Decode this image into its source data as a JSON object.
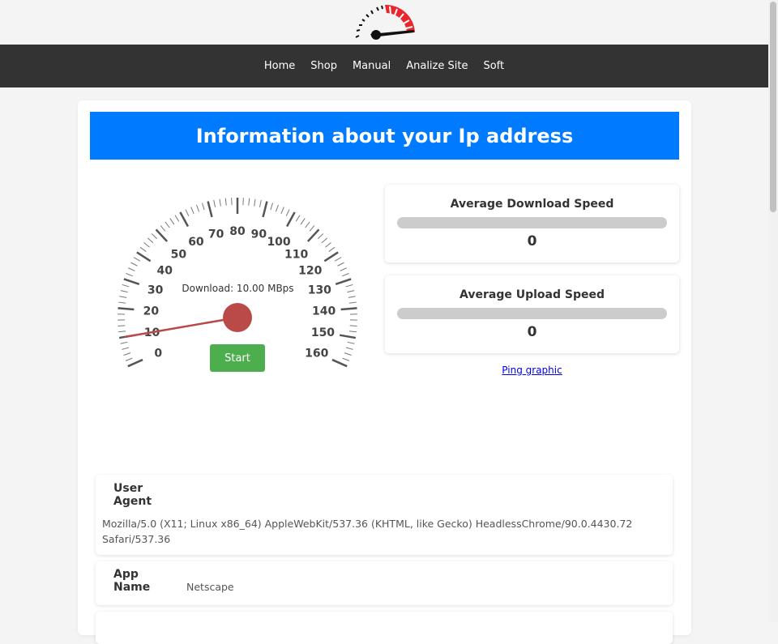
{
  "nav": {
    "items": [
      {
        "label": "Home"
      },
      {
        "label": "Shop"
      },
      {
        "label": "Manual"
      },
      {
        "label": "Analize Site"
      },
      {
        "label": "Soft"
      }
    ]
  },
  "banner": {
    "title": "Information about your Ip address"
  },
  "gauge": {
    "min": 0,
    "max": 160,
    "major_ticks": [
      0,
      10,
      20,
      30,
      40,
      50,
      60,
      70,
      80,
      90,
      100,
      110,
      120,
      130,
      140,
      150,
      160
    ],
    "needle_value": 10,
    "readout": "Download: 10.00 MBps",
    "start_label": "Start",
    "needle_color": "#b94a48",
    "button_color": "#4cae4c"
  },
  "download": {
    "title": "Average Download Speed",
    "value": "0",
    "progress": 0
  },
  "upload": {
    "title": "Average Upload Speed",
    "value": "0",
    "progress": 0
  },
  "ping_link": "Ping graphic",
  "info": {
    "user_agent": {
      "label": "User Agent",
      "value": "Mozilla/5.0 (X11; Linux x86_64) AppleWebKit/537.36 (KHTML, like Gecko) HeadlessChrome/90.0.4430.72 Safari/537.36"
    },
    "app_name": {
      "label": "App Name",
      "value": "Netscape"
    }
  },
  "colors": {
    "banner": "#007bff",
    "navbar": "#333333",
    "logo_accent": "#e8262b"
  }
}
